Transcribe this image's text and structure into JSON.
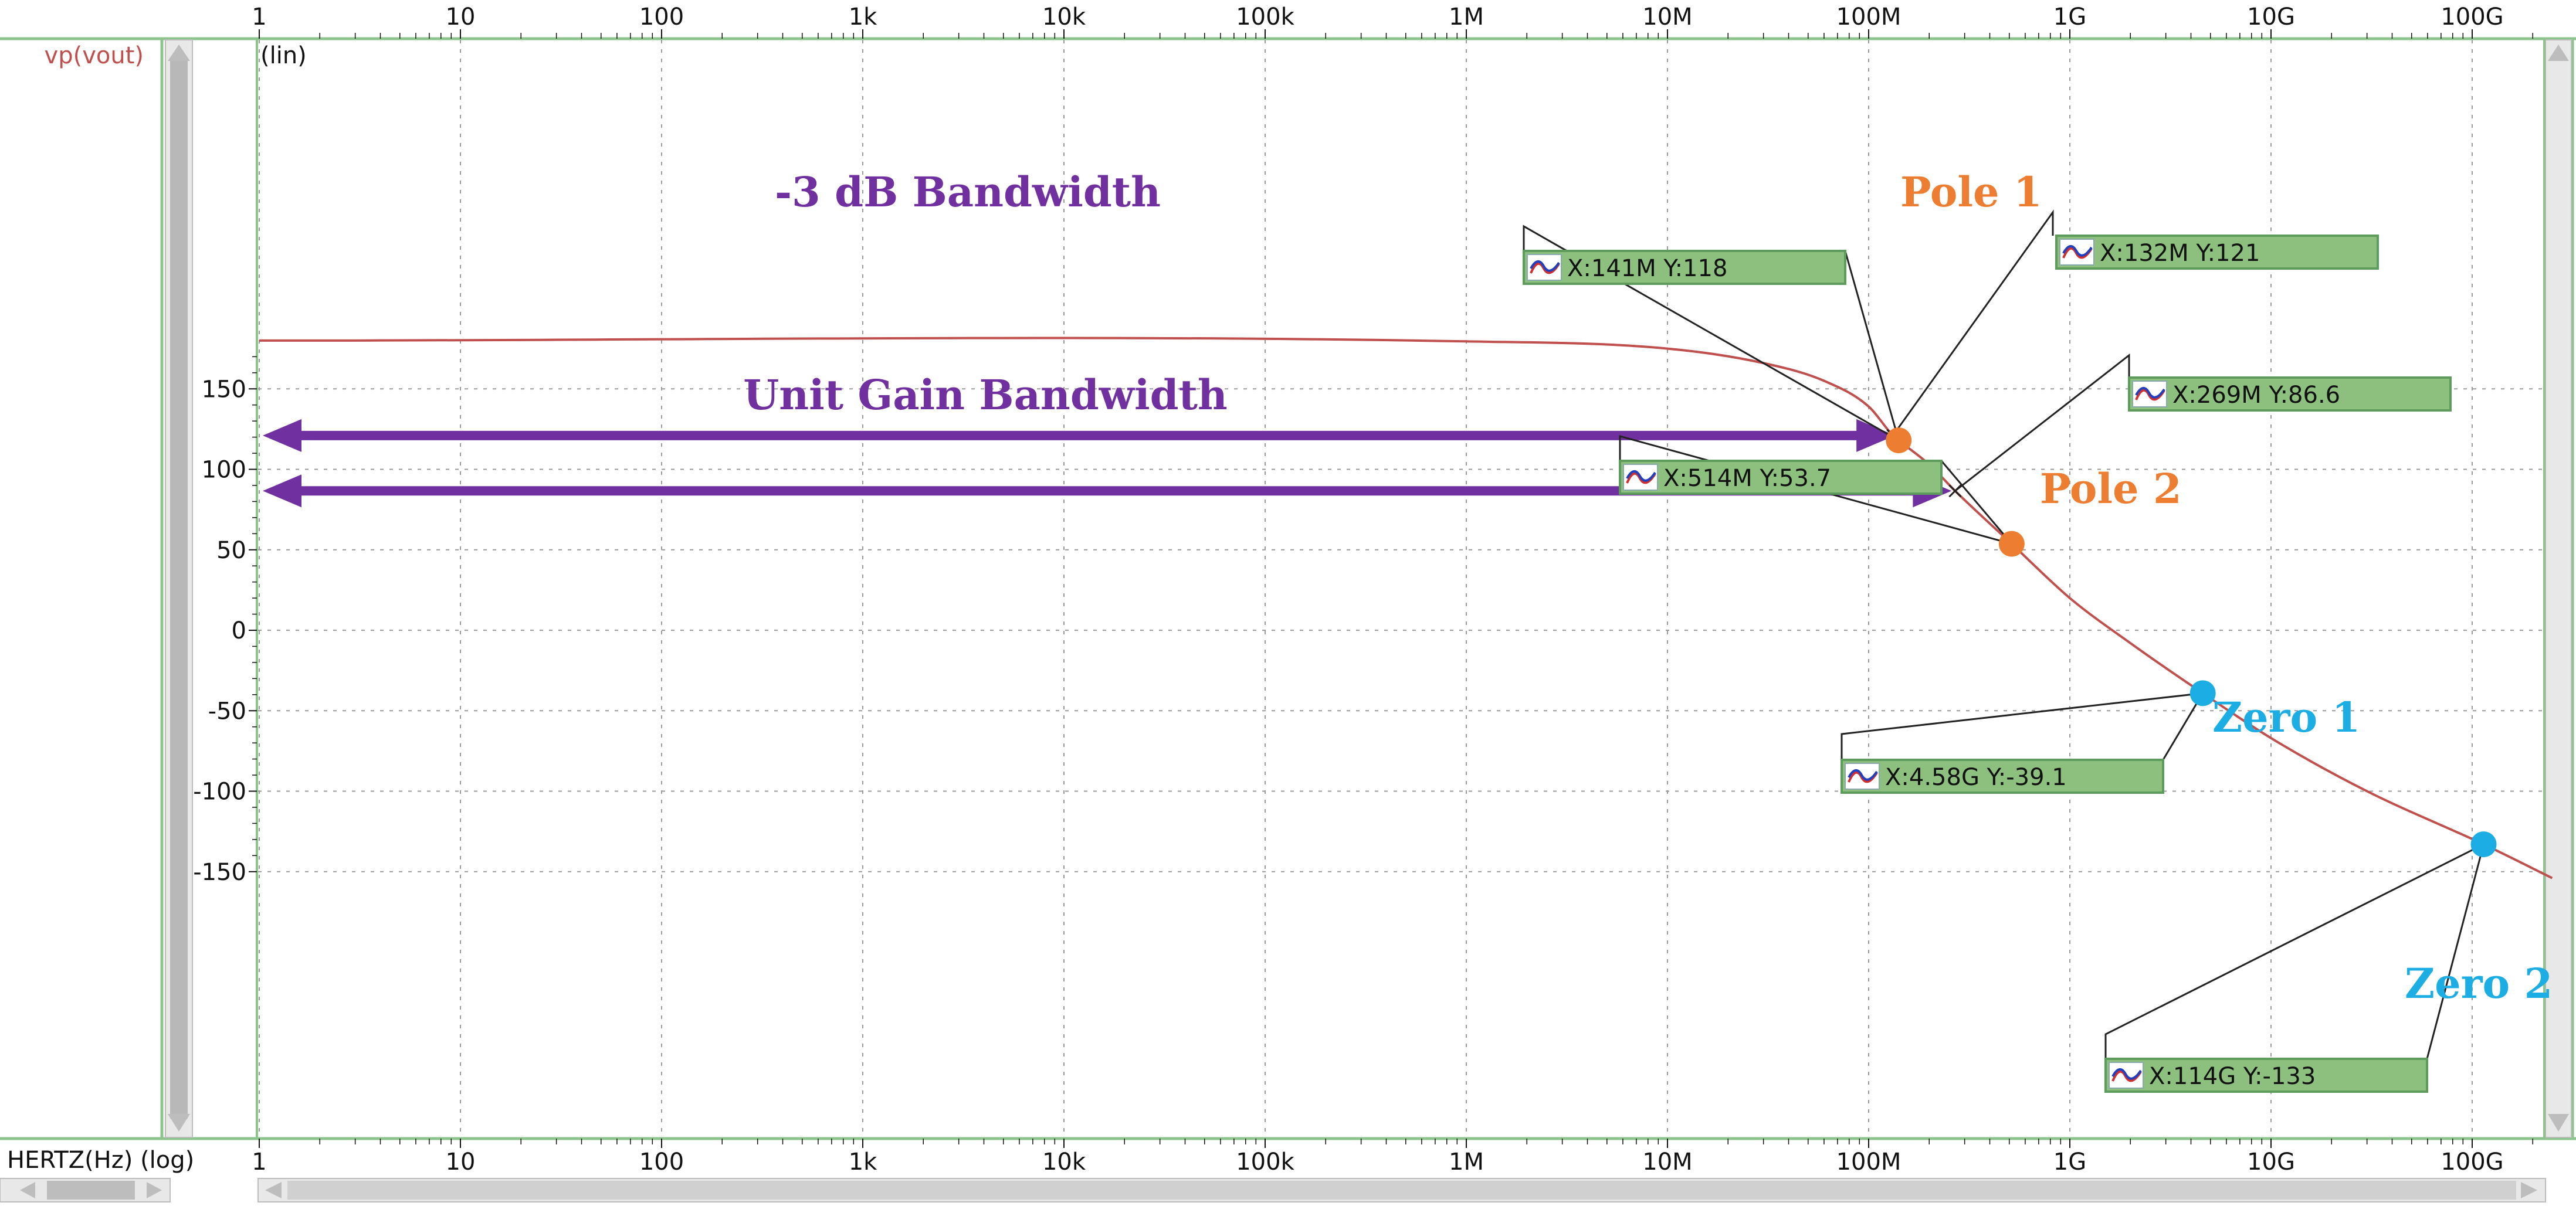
{
  "chart_data": {
    "type": "line",
    "signal_name": "vp(vout)",
    "y_scale_label": "(lin)",
    "xlabel": "HERTZ(Hz) (log)",
    "x_scale": "log",
    "x_ticks": [
      1,
      10,
      100,
      1000,
      10000,
      100000,
      1000000,
      10000000,
      100000000,
      1000000000,
      10000000000,
      100000000000
    ],
    "x_tick_labels": [
      "1",
      "10",
      "100",
      "1k",
      "10k",
      "100k",
      "1M",
      "10M",
      "100M",
      "1G",
      "10G",
      "100G"
    ],
    "y_ticks": [
      150,
      100,
      50,
      0,
      -50,
      -100,
      -150
    ],
    "y_tick_labels": [
      "150",
      "100",
      "50",
      "0",
      "-50",
      "-100",
      "-150"
    ],
    "xlim": [
      1,
      250000000000
    ],
    "ylim": [
      -155,
      183
    ],
    "grid": true,
    "series": [
      {
        "name": "vp(vout)",
        "color": "#c0504d",
        "x": [
          1,
          1000000,
          10000000,
          30000000,
          60000000,
          100000000,
          132000000,
          141000000,
          200000000,
          269000000,
          514000000,
          1000000000,
          2000000000,
          4580000000,
          10000000000,
          30000000000,
          114000000000,
          250000000000
        ],
        "y": [
          180,
          179.5,
          175,
          166,
          155,
          139,
          121,
          118,
          103,
          86.6,
          53.7,
          20,
          -8,
          -39.1,
          -67,
          -100,
          -133,
          -154
        ]
      }
    ],
    "markers": [
      {
        "label": "X:141M Y:118",
        "x": 141000000,
        "y": 118
      },
      {
        "label": "X:132M Y:121",
        "x": 132000000,
        "y": 121
      },
      {
        "label": "X:269M Y:86.6",
        "x": 269000000,
        "y": 86.6
      },
      {
        "label": "X:514M Y:53.7",
        "x": 514000000,
        "y": 53.7
      },
      {
        "label": "X:4.58G Y:-39.1",
        "x": 4580000000,
        "y": -39.1
      },
      {
        "label": "X:114G Y:-133",
        "x": 114000000000,
        "y": -133
      }
    ],
    "annotations": [
      {
        "text": "-3 dB Bandwidth",
        "color": "#7030a0"
      },
      {
        "text": "Unit Gain Bandwidth",
        "color": "#7030a0"
      },
      {
        "text": "Pole 1",
        "color": "#ed7d31",
        "x": 141000000,
        "y": 118
      },
      {
        "text": "Pole 2",
        "color": "#ed7d31",
        "x": 514000000,
        "y": 53.7
      },
      {
        "text": "Zero 1",
        "color": "#1cade4",
        "x": 4580000000,
        "y": -39.1
      },
      {
        "text": "Zero 2",
        "color": "#1cade4",
        "x": 114000000000,
        "y": -133
      }
    ],
    "arrows": [
      {
        "to_x": 141000000,
        "y": 121,
        "color": "#7030a0"
      },
      {
        "to_x": 269000000,
        "y": 86.6,
        "color": "#7030a0"
      }
    ],
    "colors": {
      "frame_green": "#8dc48d",
      "marker_box_fill": "#8dbf7f",
      "marker_box_border": "#5e9c5e",
      "grid": "#9a9a9a"
    }
  }
}
